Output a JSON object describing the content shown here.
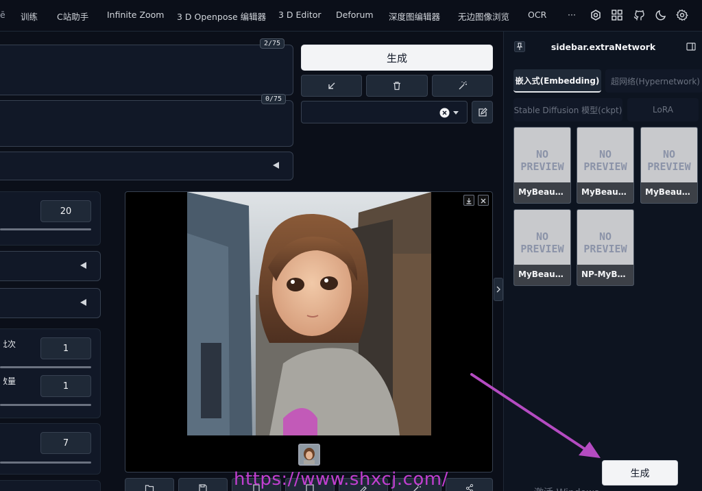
{
  "nav": {
    "tabs": [
      "训练",
      "C站助手",
      "Infinite Zoom",
      "3 D Openpose 编辑器",
      "3 D Editor",
      "Deforum",
      "深度图编辑器",
      "无边图像浏览",
      "OCR",
      "···"
    ],
    "icons": [
      "settings-hex-icon",
      "grid-icon",
      "github-icon",
      "moon-icon",
      "gear-icon"
    ]
  },
  "prompt": {
    "counter": "2/75"
  },
  "negative_prompt": {
    "counter": "0/75"
  },
  "generate": {
    "label": "生成"
  },
  "tools": {
    "icons": [
      "arrow-down-left-icon",
      "trash-icon",
      "magic-wand-icon"
    ]
  },
  "style_select": {
    "value": ""
  },
  "params": {
    "steps": "20",
    "batch_count_label": "批次",
    "batch_count": "1",
    "batch_size_label": "数量",
    "batch_size": "1",
    "cfg": "7"
  },
  "sidebar": {
    "title": "sidebar.extraNetwork",
    "tabs": [
      "嵌入式(Embedding)",
      "超网络(Hypernetwork)",
      "Stable Diffusion 模型(ckpt)",
      "LoRA"
    ],
    "placeholder_line1": "NO",
    "placeholder_line2": "PREVIEW",
    "cards": [
      "MyBeauti...",
      "MyBeauti...",
      "MyBeauti...",
      "MyBeauti...",
      "NP-MyBe..."
    ],
    "bottom_text": "激活 Windows"
  },
  "generate_bottom": {
    "label": "生成"
  },
  "watermark": "https://www.shxcj.com/",
  "colors": {
    "arrow": "#b44bc1",
    "watermark": "#c13fd0",
    "bg": "#0b0f19"
  }
}
